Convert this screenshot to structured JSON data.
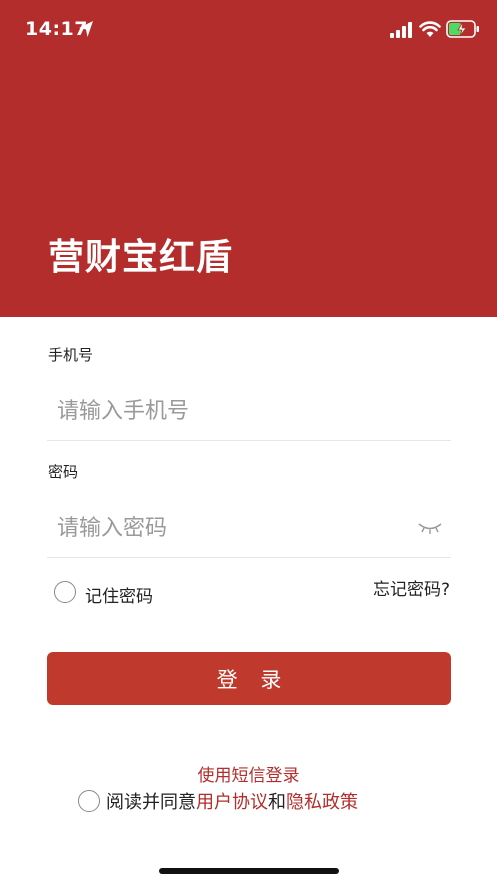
{
  "status_bar": {
    "time": "14:17"
  },
  "header": {
    "title": "营财宝红盾",
    "background_color": "#b22d2b"
  },
  "form": {
    "phone_label": "手机号",
    "phone_placeholder": "请输入手机号",
    "password_label": "密码",
    "password_placeholder": "请输入密码",
    "remember_label": "记住密码",
    "forgot_label": "忘记密码?",
    "login_label": "登 录",
    "login_button_color": "#bf3a2c"
  },
  "footer": {
    "sms_login": "使用短信登录",
    "agree_prefix": "阅读并同意",
    "user_agreement": "用户协议",
    "and": "和",
    "privacy_policy": "隐私政策"
  },
  "icons": {
    "location": "location-arrow-icon",
    "signal": "cellular-signal-icon",
    "wifi": "wifi-icon",
    "battery": "battery-charging-icon",
    "eye": "eye-closed-icon"
  }
}
